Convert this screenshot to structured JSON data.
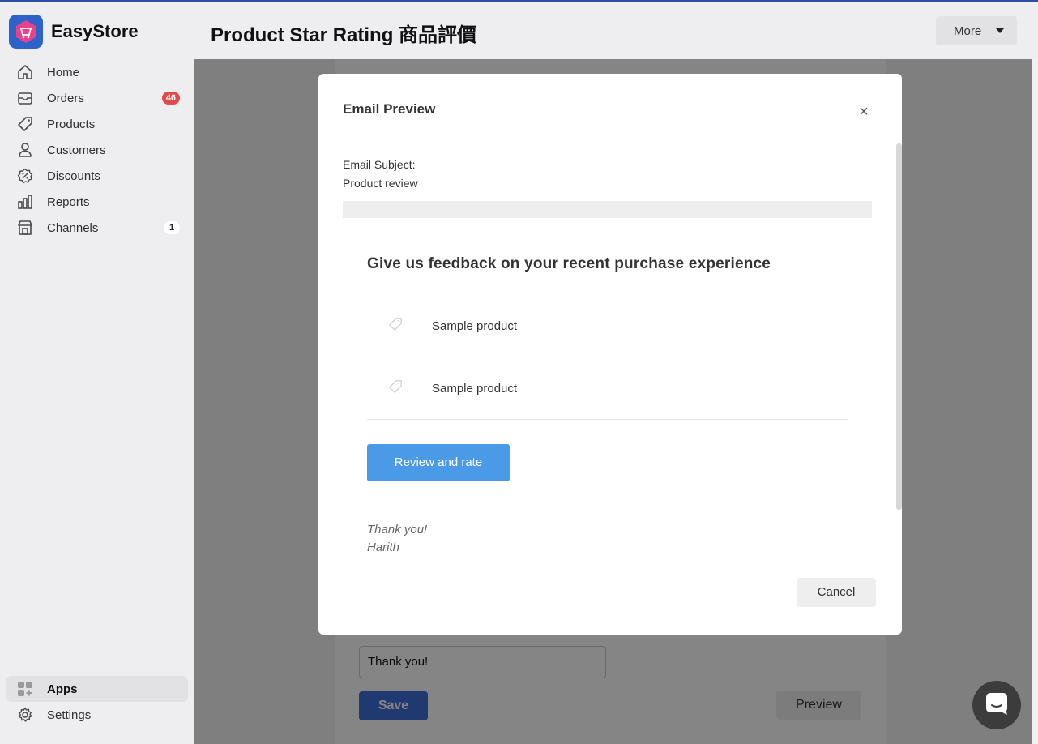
{
  "brand": {
    "name": "EasyStore"
  },
  "header": {
    "title": "Product Star Rating 商品評價",
    "more_label": "More"
  },
  "sidebar": {
    "items": [
      {
        "label": "Home",
        "icon": "home-icon"
      },
      {
        "label": "Orders",
        "icon": "inbox-icon",
        "badge": "46"
      },
      {
        "label": "Products",
        "icon": "tag-icon"
      },
      {
        "label": "Customers",
        "icon": "person-icon"
      },
      {
        "label": "Discounts",
        "icon": "discount-icon"
      },
      {
        "label": "Reports",
        "icon": "bar-chart-icon"
      },
      {
        "label": "Channels",
        "icon": "store-icon",
        "badge": "1"
      }
    ],
    "bottom_items": [
      {
        "label": "Apps",
        "icon": "apps-icon",
        "active": true
      },
      {
        "label": "Settings",
        "icon": "gear-icon"
      }
    ]
  },
  "background_form": {
    "input_value": "Thank you!",
    "save_label": "Save",
    "preview_label": "Preview"
  },
  "modal": {
    "title": "Email Preview",
    "close_symbol": "×",
    "subject_label": "Email Subject:",
    "subject_value": "Product review",
    "email": {
      "heading": "Give us feedback on your recent purchase experience",
      "products": [
        "Sample product",
        "Sample product"
      ],
      "review_button": "Review and rate",
      "thanks": "Thank you!",
      "signer": "Harith"
    },
    "cancel_label": "Cancel"
  },
  "colors": {
    "accent": "#2c4f9e",
    "orders_badge": "#e04a4a",
    "review_button": "#4a9ae8",
    "save_button": "#3f6fd8"
  }
}
